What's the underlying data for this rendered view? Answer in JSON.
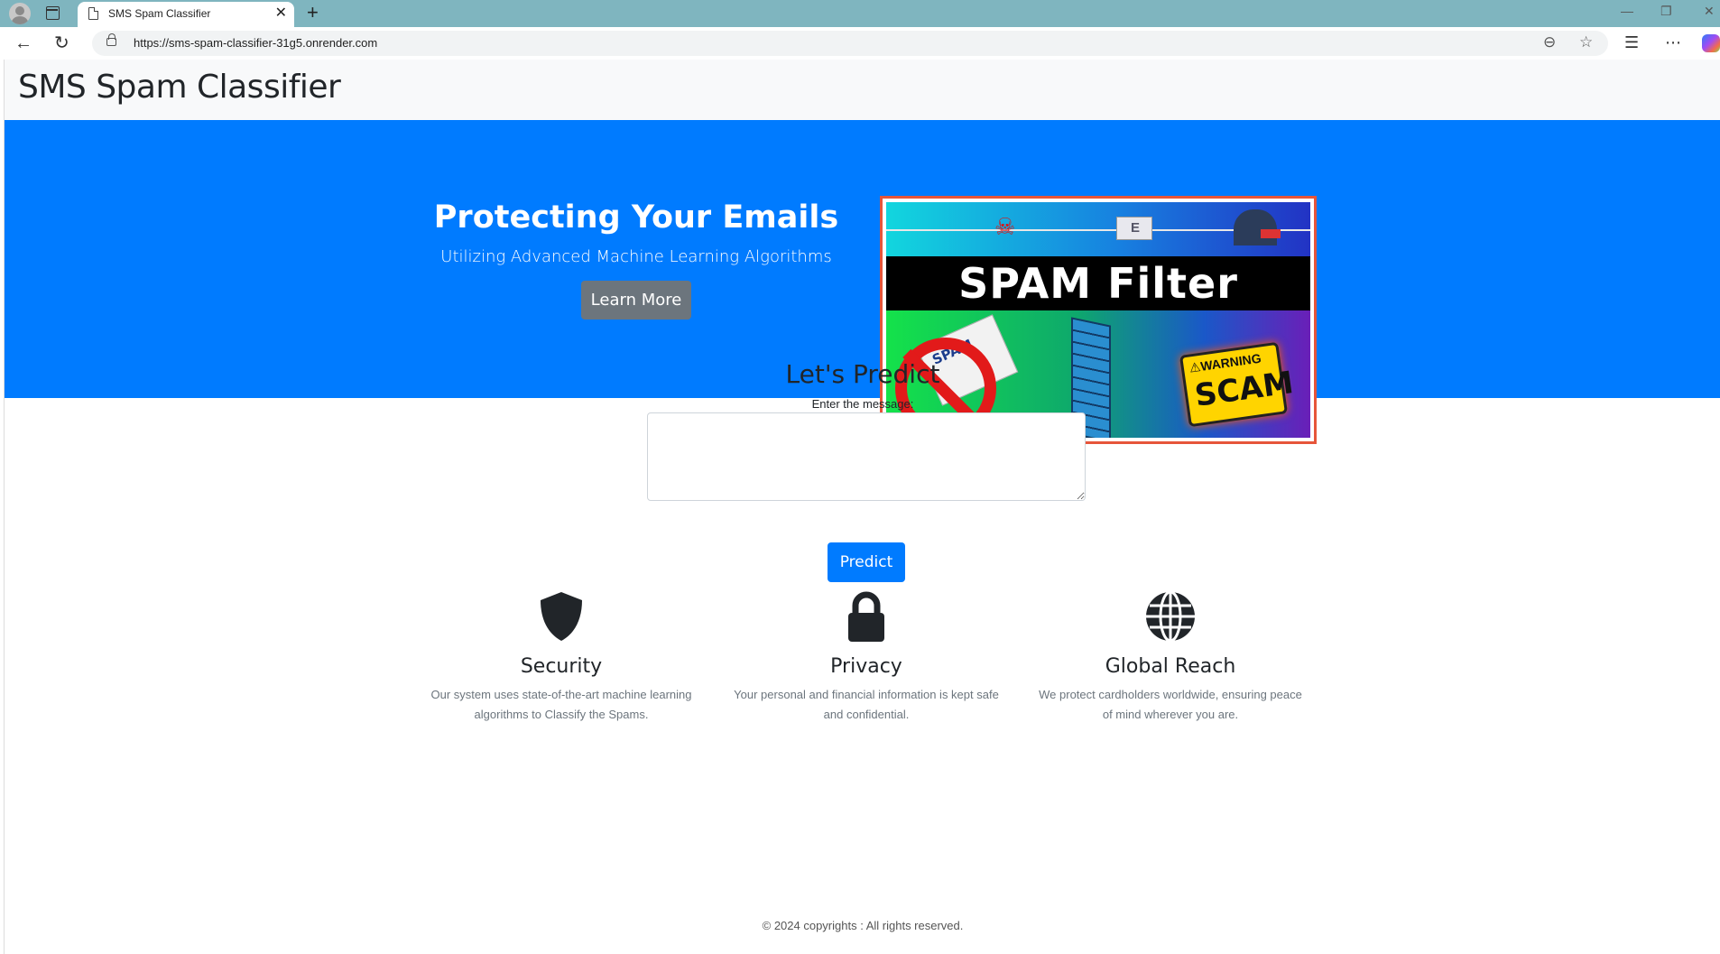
{
  "browser": {
    "tab_title": "SMS Spam Classifier",
    "tab_close": "✕",
    "new_tab": "+",
    "url": "https://sms-spam-classifier-31g5.onrender.com",
    "window_controls": [
      "—",
      "❐",
      "✕"
    ]
  },
  "navbar": {
    "brand": "SMS Spam Classifier"
  },
  "hero": {
    "title": "Protecting Your Emails",
    "subtitle": "Utilizing Advanced Machine Learning Algorithms",
    "cta_label": "Learn More",
    "image": {
      "banner_text": "SPAM Filter",
      "envelope_label": "SPAM",
      "warning_label": "⚠WARNING",
      "scam_label": "SCAM"
    }
  },
  "predict": {
    "title": "Let's Predict",
    "label": "Enter the message:",
    "message_value": "",
    "button_label": "Predict"
  },
  "features": [
    {
      "icon": "shield-icon",
      "title": "Security",
      "text": "Our system uses state-of-the-art machine learning algorithms to Classify the Spams."
    },
    {
      "icon": "lock-icon",
      "title": "Privacy",
      "text": "Your personal and financial information is kept safe and confidential."
    },
    {
      "icon": "globe-icon",
      "title": "Global Reach",
      "text": "We protect cardholders worldwide, ensuring peace of mind wherever you are."
    }
  ],
  "footer": {
    "text": "© 2024 copyrights : All rights reserved."
  },
  "colors": {
    "primary": "#007bff",
    "secondary": "#6c757d",
    "navbar_bg": "#f8f9fa",
    "tabbar_bg": "#7fb5bf"
  }
}
